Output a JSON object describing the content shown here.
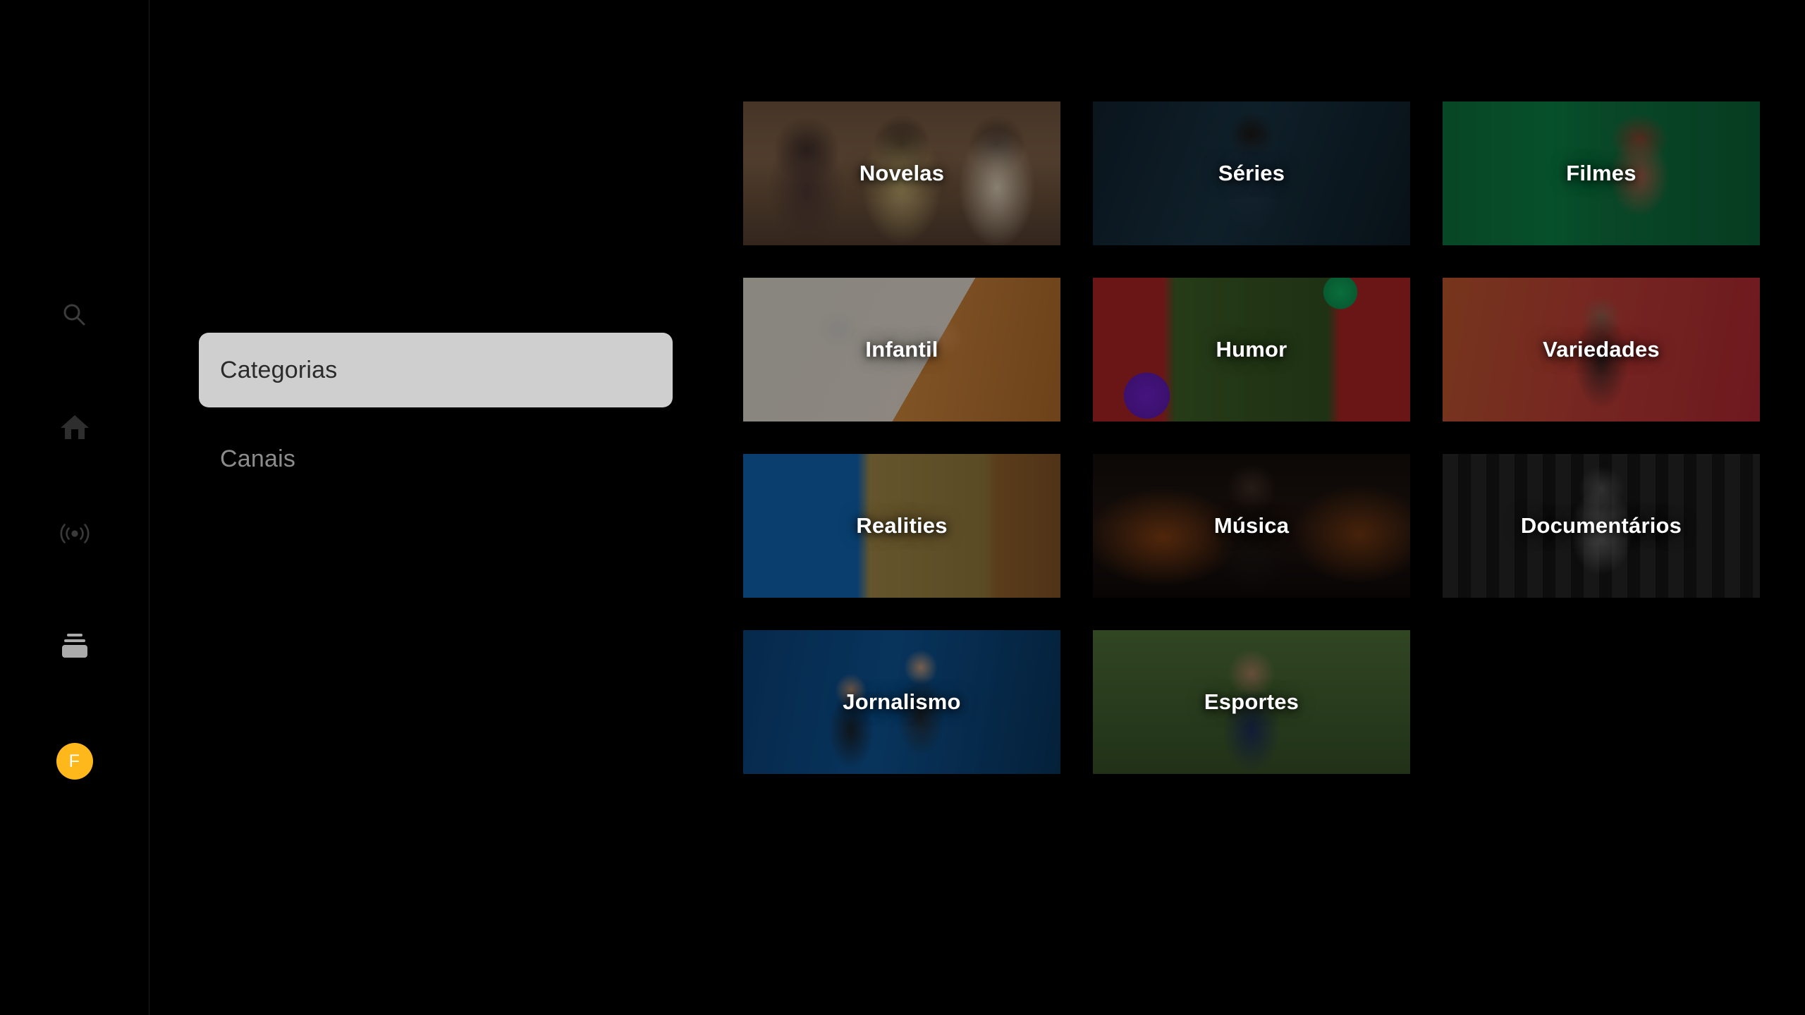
{
  "app": {
    "background_color": "#000000",
    "accent_color": "#FFB81C"
  },
  "rail": {
    "items": [
      {
        "name": "search",
        "icon": "search-icon",
        "label": "Buscar",
        "active": false
      },
      {
        "name": "home",
        "icon": "home-icon",
        "label": "Início",
        "active": false
      },
      {
        "name": "live",
        "icon": "broadcast-icon",
        "label": "Agora",
        "active": false
      },
      {
        "name": "cards",
        "icon": "stack-icon",
        "label": "Catálogo",
        "active": true
      }
    ],
    "avatar": {
      "initial": "F",
      "background_color": "#FFB81C",
      "text_color": "#FFFFFF"
    }
  },
  "menu": {
    "items": [
      {
        "label": "Categorias",
        "active": true
      },
      {
        "label": "Canais",
        "active": false
      }
    ]
  },
  "grid": {
    "tiles": [
      {
        "label": "Novelas",
        "art": "art-novelas"
      },
      {
        "label": "Séries",
        "art": "art-series"
      },
      {
        "label": "Filmes",
        "art": "art-filmes"
      },
      {
        "label": "Infantil",
        "art": "art-infantil"
      },
      {
        "label": "Humor",
        "art": "art-humor"
      },
      {
        "label": "Variedades",
        "art": "art-variedades"
      },
      {
        "label": "Realities",
        "art": "art-realities"
      },
      {
        "label": "Música",
        "art": "art-musica"
      },
      {
        "label": "Documentários",
        "art": "art-documentarios"
      },
      {
        "label": "Jornalismo",
        "art": "art-jornalismo"
      },
      {
        "label": "Esportes",
        "art": "art-esportes"
      }
    ]
  }
}
